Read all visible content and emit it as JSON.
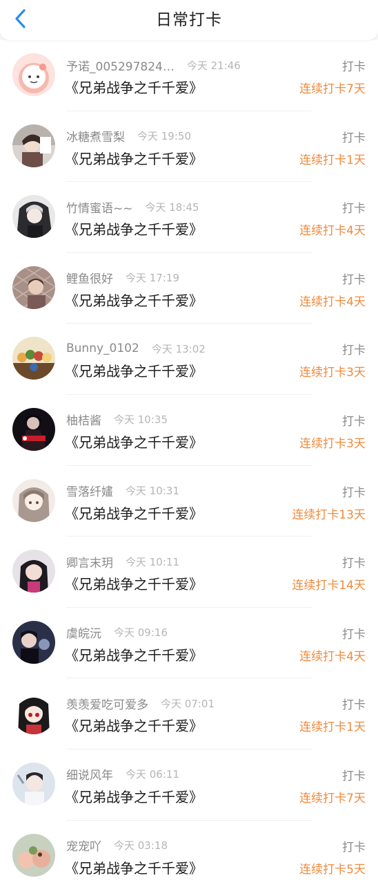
{
  "header": {
    "title": "日常打卡",
    "back_icon": "chevron-left-icon",
    "accent_color": "#2a8cf0"
  },
  "colors": {
    "streak": "#f08a3c",
    "muted": "#8a8a8a",
    "time": "#b5b5b5"
  },
  "items": [
    {
      "username": "予诺_005297824…",
      "time": "今天 21:46",
      "book": "《兄弟战争之千千爱》",
      "action": "打卡",
      "streak": "连续打卡7天"
    },
    {
      "username": "冰糖煮雪梨",
      "time": "今天 19:50",
      "book": "《兄弟战争之千千爱》",
      "action": "打卡",
      "streak": "连续打卡1天"
    },
    {
      "username": "竹情蜜语~~",
      "time": "今天 18:45",
      "book": "《兄弟战争之千千爱》",
      "action": "打卡",
      "streak": "连续打卡4天"
    },
    {
      "username": "鲤鱼很好",
      "time": "今天 17:19",
      "book": "《兄弟战争之千千爱》",
      "action": "打卡",
      "streak": "连续打卡4天"
    },
    {
      "username": "Bunny_0102",
      "time": "今天 13:02",
      "book": "《兄弟战争之千千爱》",
      "action": "打卡",
      "streak": "连续打卡3天"
    },
    {
      "username": "柚桔酱",
      "time": "今天 10:35",
      "book": "《兄弟战争之千千爱》",
      "action": "打卡",
      "streak": "连续打卡3天"
    },
    {
      "username": "雪落纤嫿",
      "time": "今天 10:31",
      "book": "《兄弟战争之千千爱》",
      "action": "打卡",
      "streak": "连续打卡13天"
    },
    {
      "username": "卿言末玥",
      "time": "今天 10:11",
      "book": "《兄弟战争之千千爱》",
      "action": "打卡",
      "streak": "连续打卡14天"
    },
    {
      "username": "虞皖沅",
      "time": "今天 09:16",
      "book": "《兄弟战争之千千爱》",
      "action": "打卡",
      "streak": "连续打卡4天"
    },
    {
      "username": "羡羡爱吃可爱多",
      "time": "今天 07:01",
      "book": "《兄弟战争之千千爱》",
      "action": "打卡",
      "streak": "连续打卡1天"
    },
    {
      "username": "细说风年",
      "time": "今天 06:11",
      "book": "《兄弟战争之千千爱》",
      "action": "打卡",
      "streak": "连续打卡7天"
    },
    {
      "username": "宠宠吖",
      "time": "今天 03:18",
      "book": "《兄弟战争之千千爱》",
      "action": "打卡",
      "streak": "连续打卡5天"
    }
  ]
}
